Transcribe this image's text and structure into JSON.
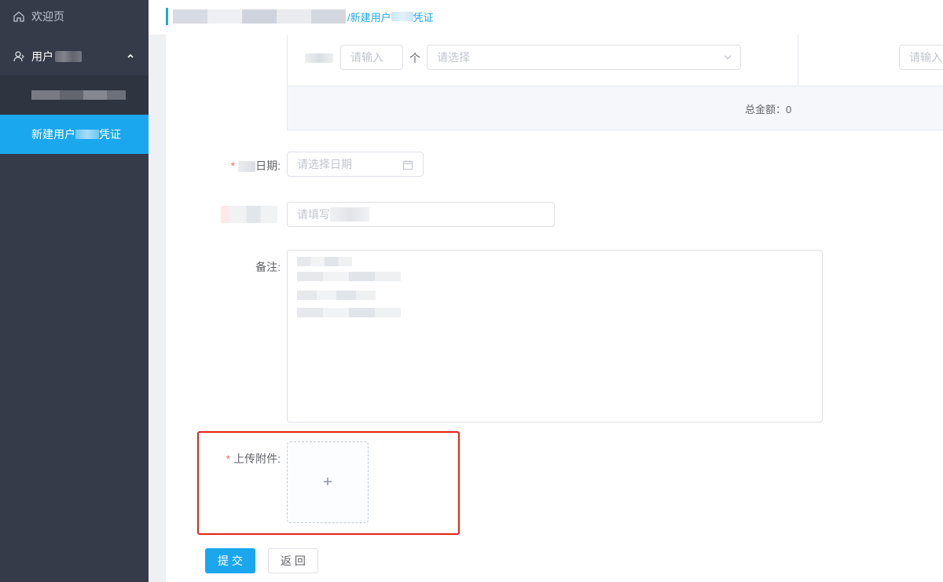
{
  "sidebar": {
    "welcome_label": "欢迎页",
    "user_menu_label": "用户",
    "active_item_label_part1": "新建用户",
    "active_item_label_part2": "凭证"
  },
  "breadcrumb": {
    "current": "/新建用户",
    "current_suffix": "凭证"
  },
  "table": {
    "qty_placeholder": "请输入",
    "unit_label": "个",
    "select_placeholder": "请选择",
    "right_input_placeholder": "请输入",
    "total_label": "总金额：0"
  },
  "form": {
    "date_label": "日期:",
    "date_placeholder": "请选择日期",
    "fill_placeholder": "请填写",
    "remark_label": "备注:",
    "upload_label": "上传附件:",
    "upload_plus": "+",
    "required_mark": "*"
  },
  "buttons": {
    "submit": "提 交",
    "back": "返 回"
  },
  "colors": {
    "sidebar_bg": "#363b49",
    "accent": "#1aa7ee",
    "highlight_border": "#e2231a",
    "required": "#f56c6c"
  },
  "icons": {
    "welcome": "home-icon",
    "user": "user-icon",
    "expand": "chevron-up-icon",
    "select": "chevron-down-icon",
    "date": "calendar-icon"
  }
}
